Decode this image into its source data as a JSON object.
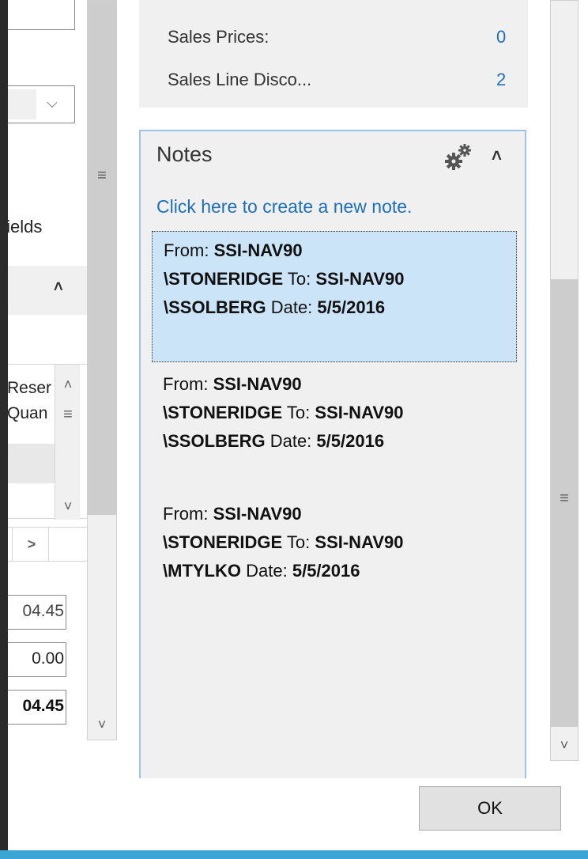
{
  "factbox": {
    "sales_prices_label": "Sales Prices:",
    "sales_prices_value": "0",
    "sales_line_disc_label": "Sales Line Disco...",
    "sales_line_disc_value": "2"
  },
  "notes": {
    "title": "Notes",
    "create_link": "Click here to create a new note.",
    "items": [
      {
        "from_label": "From:",
        "from_user": "SSI-NAV90",
        "from_domain": "\\STONERIDGE",
        "to_label": "To:",
        "to_user": "SSI-NAV90",
        "to_domain": "\\SSOLBERG",
        "date_label": "Date:",
        "date": "5/5/2016"
      },
      {
        "from_label": "From:",
        "from_user": "SSI-NAV90",
        "from_domain": "\\STONERIDGE",
        "to_label": "To:",
        "to_user": "SSI-NAV90",
        "to_domain": "\\SSOLBERG",
        "date_label": "Date:",
        "date": "5/5/2016"
      },
      {
        "from_label": "From:",
        "from_user": "SSI-NAV90",
        "from_domain": "\\STONERIDGE",
        "to_label": "To:",
        "to_user": "SSI-NAV90",
        "to_domain": "\\MTYLKO",
        "date_label": "Date:",
        "date": "5/5/2016"
      }
    ]
  },
  "left": {
    "fields_text": "fields",
    "col_header_1": "Reser",
    "col_header_2": "Quan",
    "total_1": "04.45",
    "total_2": "0.00",
    "total_3": "04.45"
  },
  "ok_label": "OK",
  "icons": {
    "grip": "≡",
    "collapse": "^",
    "up": "^",
    "down": "v",
    "right": ">",
    "dropdown": "v",
    "settings": "gears-icon"
  }
}
